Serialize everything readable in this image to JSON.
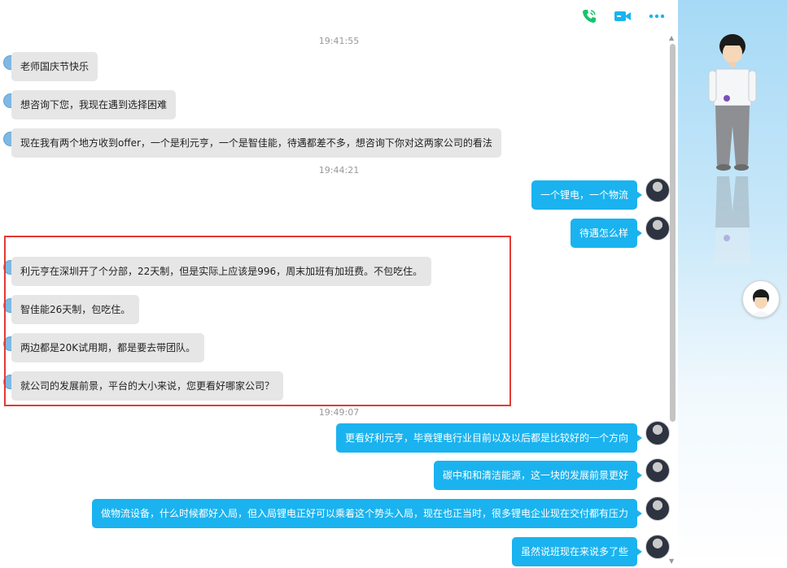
{
  "toolbar": {
    "voice_call_icon": "phone-icon",
    "video_call_icon": "video-camera-icon",
    "more_icon": "more-dots-icon",
    "accent_color": "#1ab3ef"
  },
  "messages": {
    "time1": "19:41:55",
    "m1": "老师国庆节快乐",
    "m2": "想咨询下您，我现在遇到选择困难",
    "m3": "现在我有两个地方收到offer，一个是利元亨，一个是智佳能，待遇都差不多，想咨询下你对这两家公司的看法",
    "time2": "19:44:21",
    "m4": "一个锂电，一个物流",
    "m5": "待遇怎么样",
    "m6": "利元亨在深圳开了个分部，22天制，但是实际上应该是996，周末加班有加班费。不包吃住。",
    "m7": "智佳能26天制，包吃住。",
    "m8": "两边都是20K试用期，都是要去带团队。",
    "m9": "就公司的发展前景，平台的大小来说，您更看好哪家公司？",
    "time3": "19:49:07",
    "m10": "更看好利元亨，毕竟锂电行业目前以及以后都是比较好的一个方向",
    "m11": "碳中和和清洁能源，这一块的发展前景更好",
    "m12": "做物流设备，什么时候都好入局，但入局锂电正好可以乘着这个势头入局，现在也正当时，很多锂电企业现在交付都有压力",
    "m13": "虽然说班现在来说多了些"
  },
  "colors": {
    "incoming_bubble": "#e6e6e6",
    "outgoing_bubble": "#1ab3ef",
    "highlight": "#e53935"
  }
}
